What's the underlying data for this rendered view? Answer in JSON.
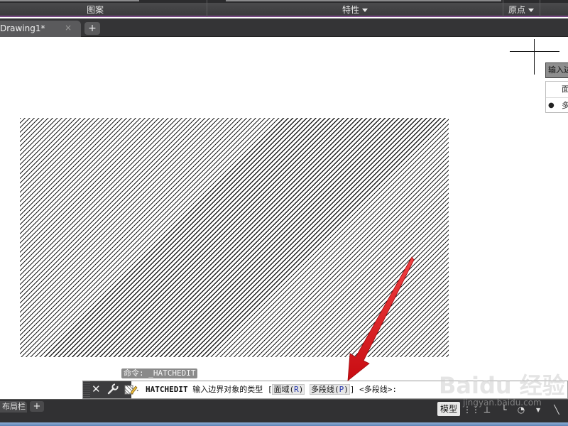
{
  "ribbon": {
    "panels": [
      {
        "label": "图案"
      },
      {
        "label": "特性"
      },
      {
        "label": "原点"
      }
    ]
  },
  "tabs": {
    "file_tab": "Drawing1*",
    "close_glyph": "×",
    "new_tab_glyph": "+"
  },
  "dynamic_menu": {
    "header": "输入边",
    "items": [
      {
        "label": "面",
        "selected": false
      },
      {
        "label": "多",
        "selected": true
      }
    ]
  },
  "command_history": "命令: _HATCHEDIT",
  "command_line": {
    "command": "HATCHEDIT",
    "prompt": "输入边界对象的类型 [",
    "option1_label": "面域(",
    "option1_key": "R",
    "option1_end": ")",
    "option2_label": "多段线(",
    "option2_key": "P",
    "option2_end": ")",
    "suffix": "] <多段线>:"
  },
  "statusbar": {
    "layout_tab": "布局栏",
    "add_glyph": "+",
    "model_button": "模型"
  },
  "watermark": {
    "brand": "Baidu 经验",
    "url": "jingyan.baidu.com"
  },
  "colors": {
    "accent_underline": "#7a4a86",
    "arrow": "#e0161c",
    "option_key": "#2233aa"
  },
  "icons": {
    "close": "close-icon",
    "wrench": "wrench-icon",
    "hatch_edit": "hatch-edit-icon",
    "crosshair": "crosshair-cursor-icon"
  }
}
